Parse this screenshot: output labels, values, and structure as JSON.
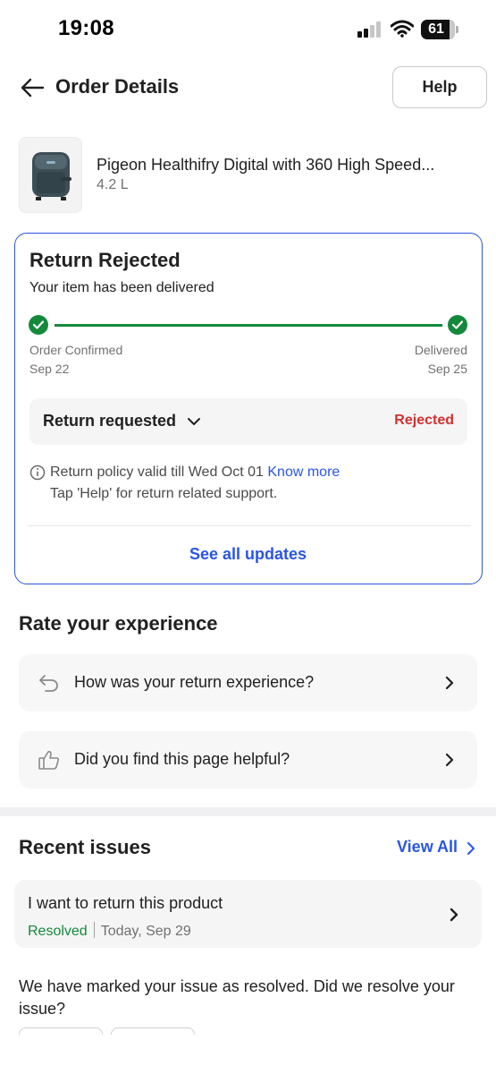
{
  "status_bar": {
    "time": "19:08",
    "battery": "61",
    "icons": [
      "signal-icon",
      "wifi-icon",
      "battery-icon"
    ]
  },
  "header": {
    "title": "Order Details",
    "help_label": "Help",
    "back_icon": "arrow-left-icon"
  },
  "product": {
    "name": "Pigeon Healthifry Digital with 360 High Speed...",
    "size": "4.2 L",
    "image_icon": "air-fryer-image"
  },
  "return_status": {
    "title": "Return Rejected",
    "subtitle": "Your item has been delivered",
    "steps": [
      {
        "label": "Order Confirmed",
        "date": "Sep 22"
      },
      {
        "label": "Delivered",
        "date": "Sep 25"
      }
    ],
    "return_label": "Return requested",
    "return_status": "Rejected",
    "policy_text": "Return policy valid till Wed Oct 01",
    "policy_link": "Know more",
    "policy_help": "Tap 'Help' for return related support.",
    "see_all": "See all updates",
    "colors": {
      "accent": "#2a55e5",
      "success": "#14893b",
      "error": "#d32f2f"
    }
  },
  "rate": {
    "title": "Rate your experience",
    "items": [
      {
        "label": "How was your return experience?",
        "icon": "return-arrow-icon"
      },
      {
        "label": "Did you find this page helpful?",
        "icon": "thumbs-up-icon"
      }
    ]
  },
  "issues": {
    "title": "Recent issues",
    "view_all": "View All",
    "items": [
      {
        "title": "I want to return this product",
        "status": "Resolved",
        "date": "Today, Sep 29"
      }
    ],
    "resolve_question": "We have marked your issue as resolved. Did we resolve your issue?"
  }
}
